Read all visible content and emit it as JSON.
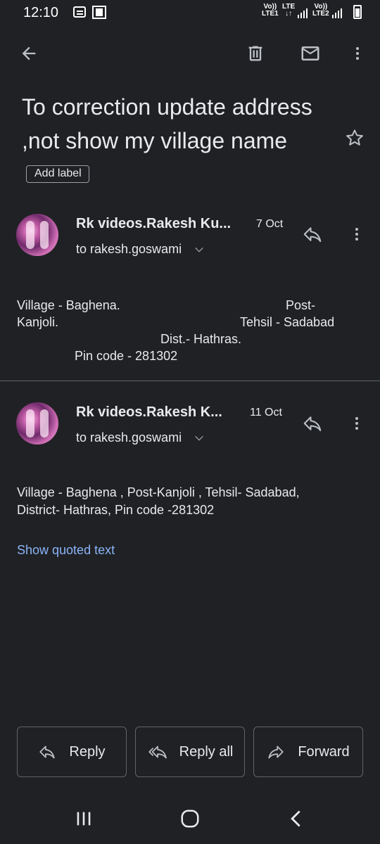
{
  "status_bar": {
    "time": "12:10",
    "sim1_line1": "Vo))",
    "sim1_line2": "LTE1",
    "net_line1": "LTE",
    "net_line2": "↓↑",
    "sim2_line1": "Vo))",
    "sim2_line2": "LTE2"
  },
  "toolbar": {
    "back_icon": "arrow-left-icon",
    "delete_icon": "trash-icon",
    "mark_unread_icon": "envelope-icon",
    "more_icon": "more-vert-icon"
  },
  "email": {
    "subject": "To correction update address ,not show my village name",
    "add_label": "Add label",
    "star_icon": "star-outline-icon"
  },
  "messages": [
    {
      "sender": "Rk videos.Rakesh Ku...",
      "date": "7 Oct",
      "recipient": "to rakesh.goswami",
      "body_lines": [
        "Village - Baghena.",
        "Post-",
        "Kanjoli.",
        "Tehsil - Sadabad",
        "Dist.- Hathras.",
        "Pin code - 281302"
      ]
    },
    {
      "sender": "Rk videos.Rakesh K...",
      "date": "11 Oct",
      "recipient": "to rakesh.goswami",
      "body_lines": [
        "Village - Baghena , Post-Kanjoli , Tehsil- Sadabad,",
        "District- Hathras, Pin code -281302"
      ],
      "show_quoted": "Show quoted text"
    }
  ],
  "actions": {
    "reply": "Reply",
    "reply_all": "Reply all",
    "forward": "Forward"
  },
  "colors": {
    "background": "#202124",
    "text": "#e8eaed",
    "link": "#8ab4f8",
    "outline": "#5f6368"
  }
}
